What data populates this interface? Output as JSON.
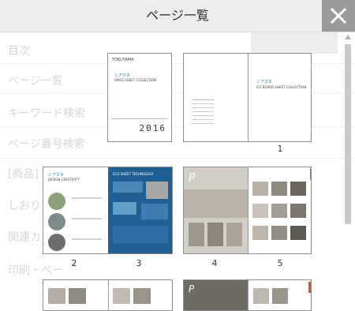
{
  "header": {
    "title": "ページ一覧"
  },
  "background_nav": {
    "items": [
      "目次",
      "ページ一覧",
      "キーワード検索",
      "ページ番号検索",
      "[商品]",
      "しおり",
      "関連カ",
      "印刷・ペー"
    ]
  },
  "thumbnails": {
    "cover": {
      "brand": "TOKUYAMA",
      "title": "シアスタ",
      "subtitle": "OMCE SHEET COLLECTION",
      "year": "2016"
    },
    "page_labels": [
      "1",
      "2",
      "3",
      "4",
      "5"
    ],
    "spread1": {
      "toc_title": "シアスタ",
      "toc_sub": "ICE BOARD SHEET COLLECTION"
    },
    "spread2": {
      "heading_left": "シアスタ",
      "heading_left_sub": "DESIGN CREATIVITY",
      "heading_right": "ECO SHEET TECHNOLOGY"
    },
    "spread3": {
      "logo": "P"
    }
  },
  "colors": {
    "header_bg": "#ececec",
    "close_bg": "#9b9b9b",
    "blue_page": "#1f5f94",
    "orange_tab": "#d6542a"
  }
}
